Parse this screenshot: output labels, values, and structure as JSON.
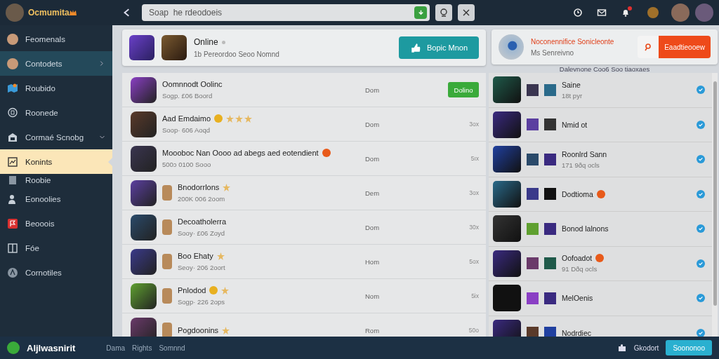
{
  "top_bar": {
    "brand": "Ocmumita",
    "search": {
      "placeholder": "Soap  he rdeodoeis"
    }
  },
  "sidebar": {
    "items": [
      {
        "label": "Feomenals",
        "selected": false,
        "highlighted": false
      },
      {
        "label": "Contodets",
        "selected": false,
        "highlighted": true,
        "expanded": false
      },
      {
        "label": "Roubido",
        "selected": false,
        "highlighted": false
      },
      {
        "label": "Roonede",
        "selected": false,
        "highlighted": false
      },
      {
        "label": "Cormaé Scnobg",
        "selected": false,
        "highlighted": false,
        "expanded": true
      },
      {
        "label": "Konints",
        "selected": true,
        "highlighted": false
      },
      {
        "label": "Roobie",
        "selected": false,
        "highlighted": false
      },
      {
        "label": "Eonoolies",
        "selected": false,
        "highlighted": false
      },
      {
        "label": "Beooois",
        "selected": false,
        "highlighted": false
      },
      {
        "label": "Fóe",
        "selected": false,
        "highlighted": false
      },
      {
        "label": "Cornotiles",
        "selected": false,
        "highlighted": false
      }
    ]
  },
  "status_card": {
    "title": "Online",
    "subtitle": "1b Pereordoo Seoo Nomnd",
    "button": "Bopic Mnon"
  },
  "promo_card": {
    "title": "Noconennifice Sonicleonte",
    "subtitle": "Ms Senreivno",
    "button": "Eaadtieooew"
  },
  "right_caption": "Dalevnone Coo6 Soo tiaoxaes",
  "games": [
    {
      "name": "Oomnnodt Oolinc",
      "subtitle": "Sogp. £06 Boord",
      "column_2": "Dom",
      "favorite": false,
      "action": {
        "kind": "button",
        "label": "Dolino"
      }
    },
    {
      "name": "Aad Emdaimo",
      "subtitle": "Soop· 606 Aoqd",
      "column_2": "Dom",
      "stars": 3,
      "favorite": false,
      "action": {
        "kind": "text",
        "label": "3ox"
      }
    },
    {
      "name": "Moooboc Nan Oooo ad abegs aed eotendient",
      "subtitle": "500ɔ 0100 Sooo",
      "column_2": "Dom",
      "favorite": false,
      "action": {
        "kind": "text",
        "label": "5ıx"
      }
    },
    {
      "name": "Bnodorrlons",
      "subtitle": "200K 006 2oom",
      "column_2": "Dem",
      "favorite": true,
      "action": {
        "kind": "text",
        "label": "3ox"
      }
    },
    {
      "name": "Decoatholerra",
      "subtitle": "Sooy· £06 Zoyd",
      "column_2": "Dom",
      "favorite": false,
      "action": {
        "kind": "text",
        "label": "30x"
      }
    },
    {
      "name": "Boo Ehaty",
      "subtitle": "Seoy· 206 2oort",
      "column_2": "Hom",
      "favorite": true,
      "action": {
        "kind": "text",
        "label": "5ox"
      }
    },
    {
      "name": "Pnlodod",
      "subtitle": "Sogp· 226 2ops",
      "column_2": "Nom",
      "favorite": true,
      "action": {
        "kind": "text",
        "label": "5ix"
      }
    },
    {
      "name": "Pogdoonins",
      "column_2": "Rom",
      "favorite": true,
      "action": {
        "kind": "text",
        "label": "50o"
      }
    }
  ],
  "friends": [
    {
      "name": "Saine",
      "subtitle": "18t pyr",
      "checked": true
    },
    {
      "name": "Nmid ot",
      "checked": true
    },
    {
      "name": "Roonlrd Sann",
      "subtitle": "171 9ðq ocls",
      "checked": true
    },
    {
      "name": "Dodtioma",
      "checked": true
    },
    {
      "name": "Bonod lalnons",
      "checked": true
    },
    {
      "name": "Oofoadot",
      "subtitle": "91 Dðq ocls",
      "checked": true
    },
    {
      "name": "MelOenis",
      "checked": true
    },
    {
      "name": "Nodrdiec",
      "checked": true
    }
  ],
  "footer": {
    "brand": "Aljlwasnirit",
    "links": [
      "Dama",
      "Rights",
      "Somnnd"
    ],
    "settings_label": "Gkodort",
    "button": "Soononoo"
  }
}
